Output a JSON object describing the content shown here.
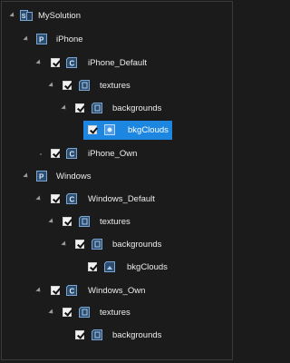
{
  "tree": {
    "nodes": [
      {
        "id": "n0",
        "label": "MySolution",
        "icon": "solution-icon",
        "level": 0,
        "checkbox": false,
        "expanded": true
      },
      {
        "id": "n1",
        "label": "iPhone",
        "icon": "project-icon",
        "level": 1,
        "checkbox": false,
        "expanded": true
      },
      {
        "id": "n2",
        "label": "iPhone_Default",
        "icon": "config-icon",
        "level": 2,
        "checkbox": true,
        "expanded": true
      },
      {
        "id": "n3",
        "label": "textures",
        "icon": "folder-icon",
        "level": 3,
        "checkbox": true,
        "expanded": true
      },
      {
        "id": "n4",
        "label": "backgrounds",
        "icon": "folder-icon",
        "level": 4,
        "checkbox": true,
        "expanded": true
      },
      {
        "id": "n5",
        "label": "bkgClouds",
        "icon": "image-icon",
        "level": 5,
        "checkbox": true,
        "expanded": false,
        "selected": true
      },
      {
        "id": "n6",
        "label": "iPhone_Own",
        "icon": "config-icon",
        "level": 2,
        "checkbox": true,
        "expanded": false
      },
      {
        "id": "n7",
        "label": "Windows",
        "icon": "project-icon",
        "level": 1,
        "checkbox": false,
        "expanded": true
      },
      {
        "id": "n8",
        "label": "Windows_Default",
        "icon": "config-icon",
        "level": 2,
        "checkbox": true,
        "expanded": true
      },
      {
        "id": "n9",
        "label": "textures",
        "icon": "folder-icon",
        "level": 3,
        "checkbox": true,
        "expanded": true
      },
      {
        "id": "n10",
        "label": "backgrounds",
        "icon": "folder-icon",
        "level": 4,
        "checkbox": true,
        "expanded": true
      },
      {
        "id": "n11",
        "label": "bkgClouds",
        "icon": "image-icon",
        "level": 5,
        "checkbox": true,
        "expanded": false
      },
      {
        "id": "n12",
        "label": "Windows_Own",
        "icon": "config-icon",
        "level": 2,
        "checkbox": true,
        "expanded": true
      },
      {
        "id": "n13",
        "label": "textures",
        "icon": "folder-icon",
        "level": 3,
        "checkbox": true,
        "expanded": true
      },
      {
        "id": "n14",
        "label": "backgrounds",
        "icon": "folder-icon",
        "level": 4,
        "checkbox": true,
        "expanded": false
      }
    ]
  },
  "colors": {
    "background": "#1b1b1b",
    "selection": "#1c86e0",
    "text": "#ececec",
    "icon_accent": "#5a8fc7"
  }
}
